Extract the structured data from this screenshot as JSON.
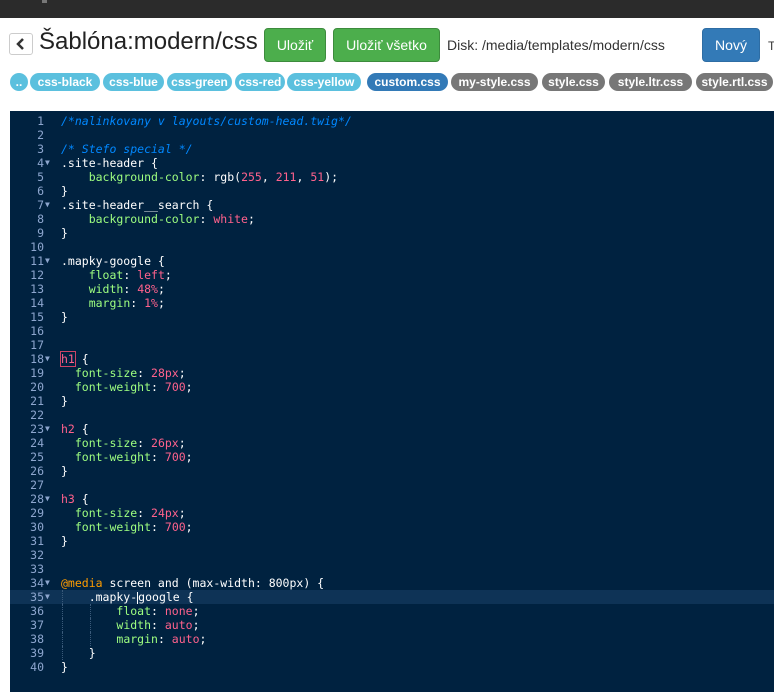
{
  "title": "Šablóna:modern/css",
  "buttons": {
    "save": "Uložiť",
    "save_all": "Uložiť všetko",
    "new": "Nový"
  },
  "disk_label": "Disk: /media/templates/modern/css",
  "cut_text": "T",
  "tags": [
    {
      "label": "..",
      "style": "cyan"
    },
    {
      "label": "css-black",
      "style": "cyan"
    },
    {
      "label": "css-blue",
      "style": "cyan"
    },
    {
      "label": "css-green",
      "style": "cyan"
    },
    {
      "label": "css-red",
      "style": "cyan"
    },
    {
      "label": "css-yellow",
      "style": "cyan"
    },
    {
      "label": "custom.css",
      "style": "blue"
    },
    {
      "label": "my-style.css",
      "style": "gray"
    },
    {
      "label": "style.css",
      "style": "gray"
    },
    {
      "label": "style.ltr.css",
      "style": "gray"
    },
    {
      "label": "style.rtl.css",
      "style": "gray"
    }
  ],
  "icons": {
    "back": "chevron-left-icon",
    "fold": "fold-arrow-icon"
  },
  "colors": {
    "editor_bg": "#002240",
    "green": "#4cae4c",
    "blue": "#337ab7",
    "cyan": "#5bc0de",
    "gray": "#777777"
  },
  "editor": {
    "active_line": 35,
    "lines": [
      {
        "n": 1,
        "text": "/*nalinkovany v layouts/custom-head.twig*/"
      },
      {
        "n": 2,
        "text": ""
      },
      {
        "n": 3,
        "text": "/* Stefo special */"
      },
      {
        "n": 4,
        "text": ".site-header {",
        "fold": true
      },
      {
        "n": 5,
        "text": "    background-color: rgb(255, 211, 51);"
      },
      {
        "n": 6,
        "text": "}"
      },
      {
        "n": 7,
        "text": ".site-header__search {",
        "fold": true
      },
      {
        "n": 8,
        "text": "    background-color: white;"
      },
      {
        "n": 9,
        "text": "}"
      },
      {
        "n": 10,
        "text": ""
      },
      {
        "n": 11,
        "text": ".mapky-google {",
        "fold": true
      },
      {
        "n": 12,
        "text": "    float: left;"
      },
      {
        "n": 13,
        "text": "    width: 48%;"
      },
      {
        "n": 14,
        "text": "    margin: 1%;"
      },
      {
        "n": 15,
        "text": "}"
      },
      {
        "n": 16,
        "text": ""
      },
      {
        "n": 17,
        "text": ""
      },
      {
        "n": 18,
        "text": "h1 {",
        "fold": true
      },
      {
        "n": 19,
        "text": "  font-size: 28px;"
      },
      {
        "n": 20,
        "text": "  font-weight: 700;"
      },
      {
        "n": 21,
        "text": "}"
      },
      {
        "n": 22,
        "text": ""
      },
      {
        "n": 23,
        "text": "h2 {",
        "fold": true
      },
      {
        "n": 24,
        "text": "  font-size: 26px;"
      },
      {
        "n": 25,
        "text": "  font-weight: 700;"
      },
      {
        "n": 26,
        "text": "}"
      },
      {
        "n": 27,
        "text": ""
      },
      {
        "n": 28,
        "text": "h3 {",
        "fold": true
      },
      {
        "n": 29,
        "text": "  font-size: 24px;"
      },
      {
        "n": 30,
        "text": "  font-weight: 700;"
      },
      {
        "n": 31,
        "text": "}"
      },
      {
        "n": 32,
        "text": ""
      },
      {
        "n": 33,
        "text": ""
      },
      {
        "n": 34,
        "text": "@media screen and (max-width: 800px) {",
        "fold": true
      },
      {
        "n": 35,
        "text": "    .mapky-google {",
        "fold": true
      },
      {
        "n": 36,
        "text": "        float: none;"
      },
      {
        "n": 37,
        "text": "        width: auto;"
      },
      {
        "n": 38,
        "text": "        margin: auto;"
      },
      {
        "n": 39,
        "text": "    }"
      },
      {
        "n": 40,
        "text": "}"
      }
    ]
  }
}
